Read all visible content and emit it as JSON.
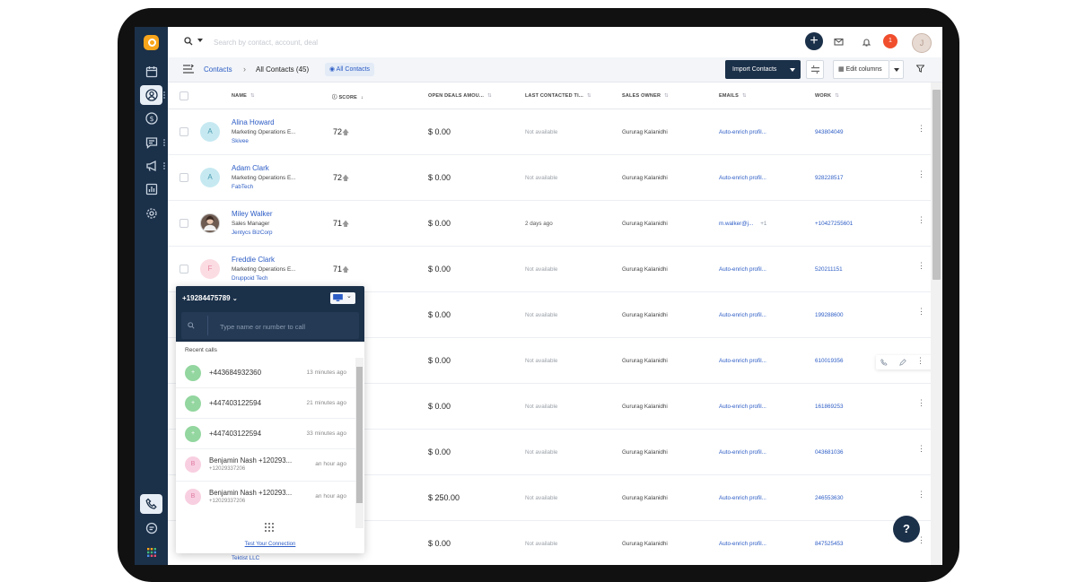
{
  "topbar": {
    "search_placeholder": "Search by contact, account, deal",
    "notification_count": "1",
    "user_initial": "J"
  },
  "toolbar": {
    "breadcrumb_root": "Contacts",
    "view_title": "All Contacts",
    "view_count": "(45)",
    "view_pill": "All Contacts",
    "import_label": "Import Contacts",
    "edit_columns_label": "Edit columns"
  },
  "columns": [
    "NAME",
    "SCORE",
    "OPEN DEALS AMOU...",
    "LAST CONTACTED TI...",
    "SALES OWNER",
    "EMAILS",
    "WORK"
  ],
  "contacts": [
    {
      "initial": "A",
      "name": "Alina Howard",
      "job": "Marketing Operations E...",
      "company": "Skivee",
      "score": "72",
      "deals": "$ 0.00",
      "last_contacted": "Not available",
      "owner": "Gururag Kalanidhi",
      "email": "Auto-enrich profil...",
      "email_more": "",
      "work": "943804049"
    },
    {
      "initial": "A",
      "name": "Adam Clark",
      "job": "Marketing Operations E...",
      "company": "FabTech",
      "score": "72",
      "deals": "$ 0.00",
      "last_contacted": "Not available",
      "owner": "Gururag Kalanidhi",
      "email": "Auto-enrich profil...",
      "email_more": "",
      "work": "928228517"
    },
    {
      "initial": "",
      "name": "Miley Walker",
      "job": "Sales Manager",
      "company": "Jentycs BizCorp",
      "score": "71",
      "deals": "$ 0.00",
      "last_contacted": "2 days ago",
      "owner": "Gururag Kalanidhi",
      "email": "m.walker@j...",
      "email_more": "+1",
      "work": "+10427255601"
    },
    {
      "initial": "F",
      "name": "Freddie Clark",
      "job": "Marketing Operations E...",
      "company": "Druppoid Tech",
      "score": "71",
      "deals": "$ 0.00",
      "last_contacted": "Not available",
      "owner": "Gururag Kalanidhi",
      "email": "Auto-enrich profil...",
      "email_more": "",
      "work": "520211151"
    },
    {
      "initial": "",
      "name": "",
      "job": "",
      "company": "",
      "score": "",
      "deals": "$ 0.00",
      "last_contacted": "Not available",
      "owner": "Gururag Kalanidhi",
      "email": "Auto-enrich profil...",
      "email_more": "",
      "work": "199288600"
    },
    {
      "initial": "",
      "name": "",
      "job": "",
      "company": "",
      "score": "",
      "deals": "$ 0.00",
      "last_contacted": "Not available",
      "owner": "Gururag Kalanidhi",
      "email": "Auto-enrich profil...",
      "email_more": "",
      "work": "610019356"
    },
    {
      "initial": "",
      "name": "",
      "job": "",
      "company": "",
      "score": "",
      "deals": "$ 0.00",
      "last_contacted": "Not available",
      "owner": "Gururag Kalanidhi",
      "email": "Auto-enrich profil...",
      "email_more": "",
      "work": "161869253"
    },
    {
      "initial": "",
      "name": "",
      "job": "",
      "company": "",
      "score": "",
      "deals": "$ 0.00",
      "last_contacted": "Not available",
      "owner": "Gururag Kalanidhi",
      "email": "Auto-enrich profil...",
      "email_more": "",
      "work": "043681036"
    },
    {
      "initial": "",
      "name": "",
      "job": "",
      "company": "",
      "score": "",
      "deals": "$ 250.00",
      "last_contacted": "Not available",
      "owner": "Gururag Kalanidhi",
      "email": "Auto-enrich profil...",
      "email_more": "",
      "work": "246553630"
    },
    {
      "initial": "",
      "name": "",
      "job": "",
      "company": "Tektist LLC",
      "score": "",
      "deals": "$ 0.00",
      "last_contacted": "Not available",
      "owner": "Gururag Kalanidhi",
      "email": "Auto-enrich profil...",
      "email_more": "",
      "work": "847525453"
    }
  ],
  "phone": {
    "number": "+19284475789",
    "search_placeholder": "Type name or number to call",
    "recent_label": "Recent calls",
    "calls": [
      {
        "initial": "+",
        "title": "+443684932360",
        "sub": "",
        "time": "13 minutes ago"
      },
      {
        "initial": "+",
        "title": "+447403122594",
        "sub": "",
        "time": "21 minutes ago"
      },
      {
        "initial": "+",
        "title": "+447403122594",
        "sub": "",
        "time": "33 minutes ago"
      },
      {
        "initial": "B",
        "title": "Benjamin Nash +120293...",
        "sub": "+12029337206",
        "time": "an hour ago"
      },
      {
        "initial": "B",
        "title": "Benjamin Nash +120293...",
        "sub": "+12029337206",
        "time": "an hour ago"
      }
    ],
    "test_link": "Test Your Connection"
  },
  "help_label": "?",
  "colors": {
    "navy": "#1b3049",
    "link": "#2c5cc5",
    "badge": "#f04e2d",
    "logo": "#f9a51b"
  }
}
